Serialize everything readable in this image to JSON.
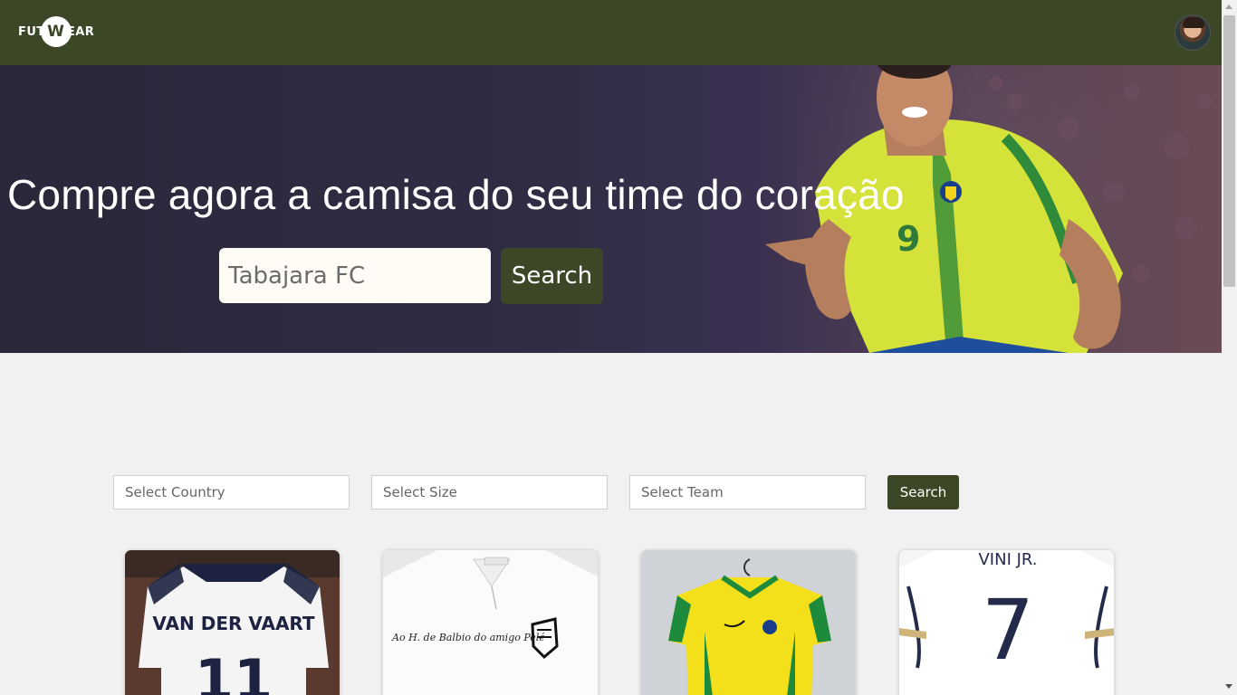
{
  "navbar": {
    "logo_left": "FUT",
    "logo_circle": "W",
    "logo_right": "EAR"
  },
  "hero": {
    "title": "Compre agora a camisa do seu time do coração",
    "search_placeholder": "Tabajara FC",
    "search_button": "Search"
  },
  "filters": {
    "country_placeholder": "Select Country",
    "size_placeholder": "Select Size",
    "team_placeholder": "Select Team",
    "search_button": "Search"
  },
  "cards": [
    {
      "name_text": "VAN DER VAART",
      "number": "11"
    },
    {
      "signature": "Ao H. de Balbio do amigo Pelé"
    },
    {
      "name_text": ""
    },
    {
      "name_text": "VINI JR.",
      "number": "7"
    }
  ],
  "colors": {
    "brand": "#3b4726",
    "page_bg": "#f1f1f1"
  }
}
